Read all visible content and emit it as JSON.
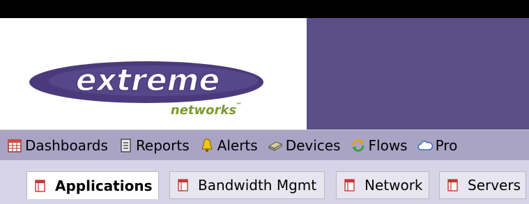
{
  "brand": {
    "logo_text": "extreme",
    "logo_subtext": "networks",
    "trademark": "™"
  },
  "colors": {
    "topbar": "#000000",
    "brand_panel": "#5b4f87",
    "logo_purple": "#4b3a7b",
    "logo_green": "#7a9a2f",
    "nav_bg": "#a9a4c4",
    "subtab_bg": "#d6d4e6",
    "tab_inactive_bg": "#e7e6f0",
    "tab_icon_red": "#c93636"
  },
  "nav": {
    "items": [
      {
        "label": "Dashboards",
        "icon": "calendar-grid-icon"
      },
      {
        "label": "Reports",
        "icon": "document-icon"
      },
      {
        "label": "Alerts",
        "icon": "bell-icon"
      },
      {
        "label": "Devices",
        "icon": "device-icon"
      },
      {
        "label": "Flows",
        "icon": "flows-icon"
      },
      {
        "label": "Pro",
        "icon": "cloud-icon"
      }
    ]
  },
  "tabs": {
    "items": [
      {
        "label": "Applications",
        "active": true,
        "icon": "report-page-icon"
      },
      {
        "label": "Bandwidth Mgmt",
        "active": false,
        "icon": "report-page-icon"
      },
      {
        "label": "Network",
        "active": false,
        "icon": "report-page-icon"
      },
      {
        "label": "Servers",
        "active": false,
        "icon": "report-page-icon"
      }
    ]
  }
}
